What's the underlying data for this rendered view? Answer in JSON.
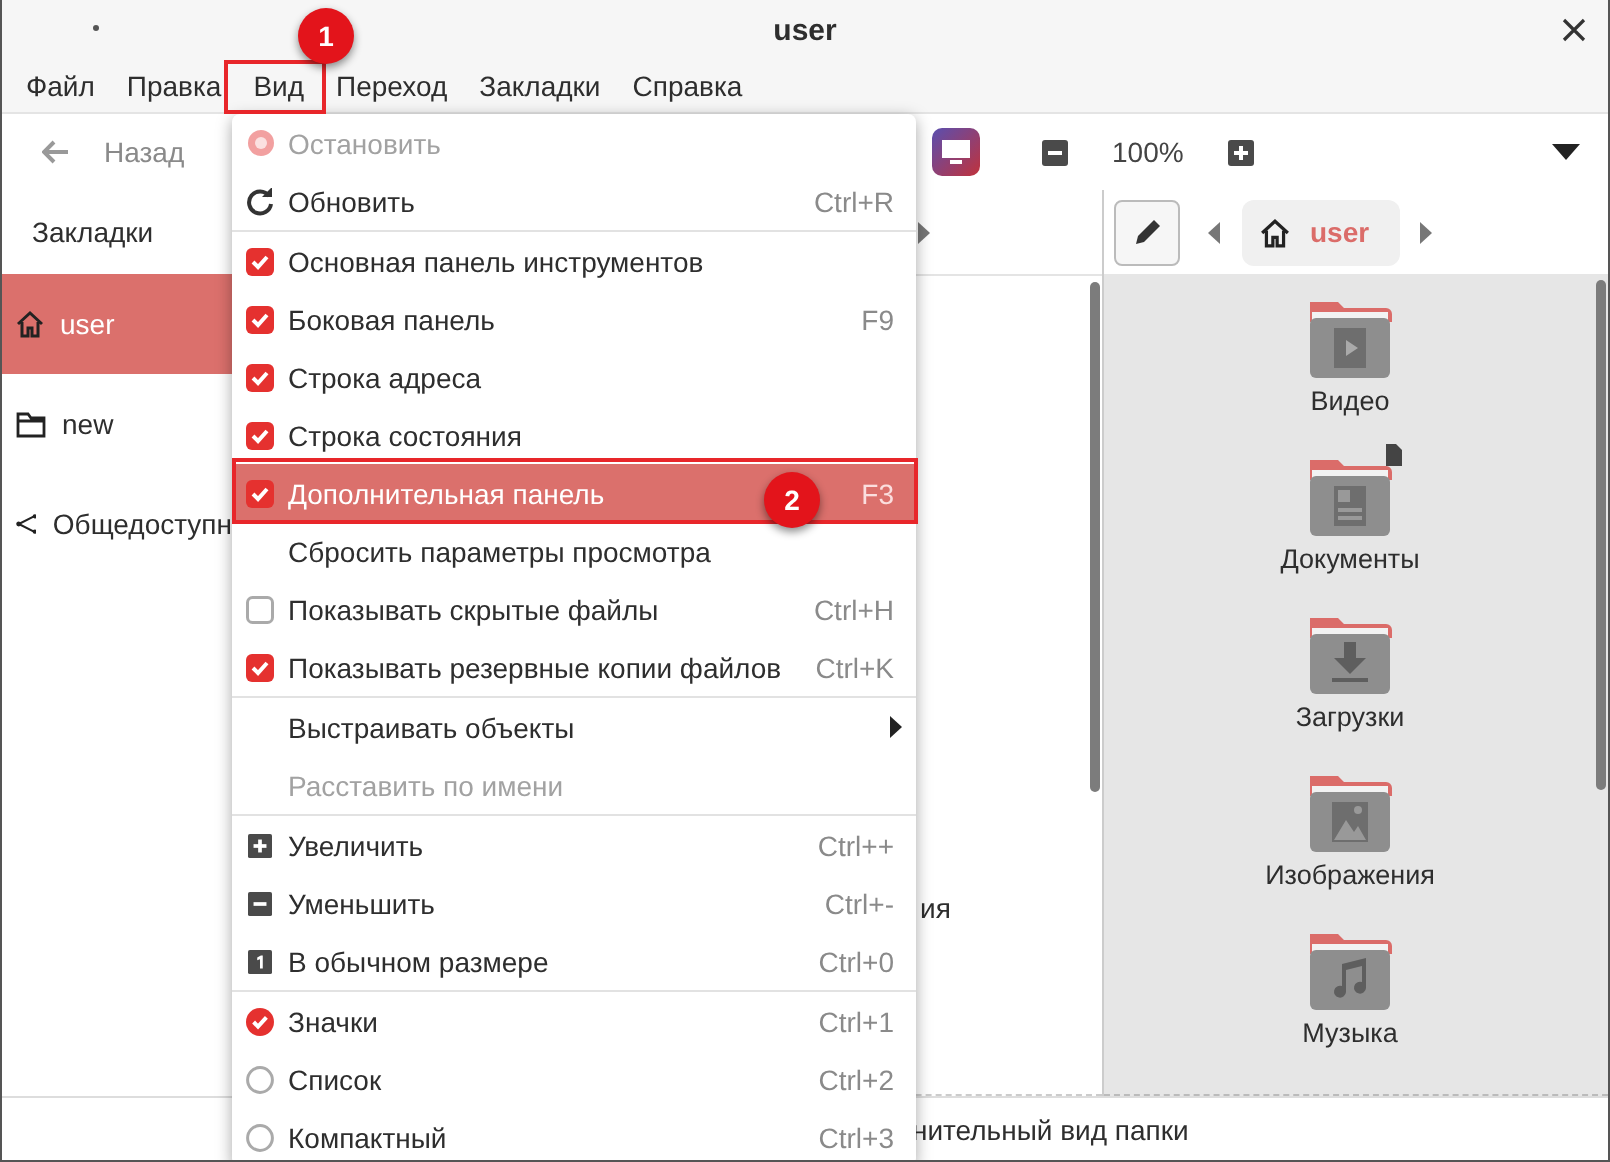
{
  "window": {
    "title": "user"
  },
  "menubar": [
    "Файл",
    "Правка",
    "Вид",
    "Переход",
    "Закладки",
    "Справка"
  ],
  "toolbar": {
    "back": {
      "label": "Назад",
      "disabled": true
    },
    "zoom": "100%"
  },
  "sidebar": {
    "header": "Закладки",
    "items": [
      {
        "label": "user",
        "kind": "home",
        "selected": true
      },
      {
        "label": "new",
        "kind": "folder",
        "selected": false
      },
      {
        "label": "Общедоступн",
        "kind": "share",
        "selected": false
      }
    ]
  },
  "left_pane": {
    "text": "ия"
  },
  "right_pane": {
    "breadcrumb": "user",
    "items": [
      {
        "label": "Видео",
        "kind": "video"
      },
      {
        "label": "Документы",
        "kind": "documents"
      },
      {
        "label": "Загрузки",
        "kind": "downloads"
      },
      {
        "label": "Изображения",
        "kind": "pictures"
      },
      {
        "label": "Музыка",
        "kind": "music"
      }
    ]
  },
  "status_bar": "нительный вид папки",
  "menu": {
    "groups": [
      [
        {
          "kind": "stop",
          "label": "Остановить",
          "disabled": true,
          "selected": false
        },
        {
          "kind": "refresh",
          "label": "Обновить",
          "shortcut": "Ctrl+R",
          "disabled": false,
          "selected": false
        }
      ],
      [
        {
          "kind": "check",
          "label": "Основная панель инструментов",
          "checked": true,
          "disabled": false,
          "selected": false
        },
        {
          "kind": "check",
          "label": "Боковая панель",
          "shortcut": "F9",
          "checked": true,
          "disabled": false,
          "selected": false
        },
        {
          "kind": "check",
          "label": "Строка адреса",
          "checked": true,
          "disabled": false,
          "selected": false
        },
        {
          "kind": "check",
          "label": "Строка состояния",
          "checked": true,
          "disabled": false,
          "selected": false
        },
        {
          "kind": "check",
          "label": "Дополнительная панель",
          "shortcut": "F3",
          "checked": true,
          "disabled": false,
          "selected": true
        },
        {
          "kind": "plain",
          "label": "Сбросить параметры просмотра",
          "disabled": false,
          "selected": false
        },
        {
          "kind": "check",
          "label": "Показывать скрытые файлы",
          "shortcut": "Ctrl+H",
          "checked": false,
          "disabled": false,
          "selected": false
        },
        {
          "kind": "check",
          "label": "Показывать резервные копии файлов",
          "shortcut": "Ctrl+K",
          "checked": true,
          "disabled": false,
          "selected": false
        }
      ],
      [
        {
          "kind": "submenu",
          "label": "Выстраивать объекты",
          "disabled": false,
          "selected": false
        },
        {
          "kind": "plain",
          "label": "Расставить по имени",
          "disabled": true,
          "selected": false
        }
      ],
      [
        {
          "kind": "zoom-in",
          "label": "Увеличить",
          "shortcut": "Ctrl++",
          "disabled": false,
          "selected": false
        },
        {
          "kind": "zoom-out",
          "label": "Уменьшить",
          "shortcut": "Ctrl+-",
          "disabled": false,
          "selected": false
        },
        {
          "kind": "zoom-normal",
          "label": "В обычном размере",
          "shortcut": "Ctrl+0",
          "disabled": false,
          "selected": false
        }
      ],
      [
        {
          "kind": "radio",
          "label": "Значки",
          "shortcut": "Ctrl+1",
          "checked": true,
          "disabled": false,
          "selected": false
        },
        {
          "kind": "radio",
          "label": "Список",
          "shortcut": "Ctrl+2",
          "checked": false,
          "disabled": false,
          "selected": false
        },
        {
          "kind": "radio",
          "label": "Компактный",
          "shortcut": "Ctrl+3",
          "checked": false,
          "disabled": false,
          "selected": false
        }
      ]
    ]
  },
  "annotations": [
    {
      "label": "1"
    },
    {
      "label": "2"
    }
  ]
}
